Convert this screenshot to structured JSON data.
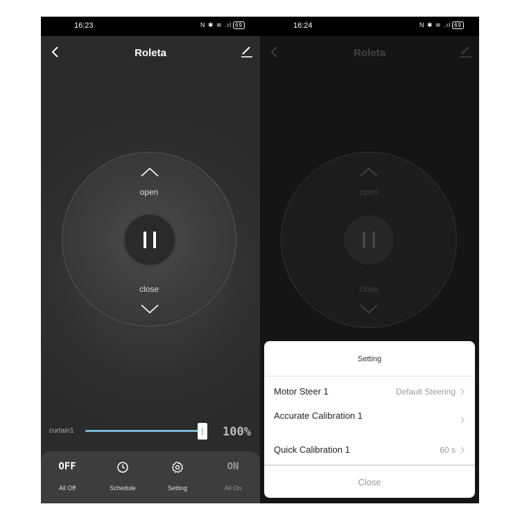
{
  "left": {
    "status_time": "16:23",
    "status_icons": "N ✱ ≋ .ıl",
    "battery": "69",
    "title": "Roleta",
    "open_label": "open",
    "close_label": "close",
    "curtain_label": "curtain1",
    "position_percent": "100%",
    "position_value": 1.0,
    "bottom_items": [
      {
        "icon_text": "OFF",
        "label": "All Off"
      },
      {
        "icon_text": "",
        "label": "Schedule"
      },
      {
        "icon_text": "",
        "label": "Setting"
      },
      {
        "icon_text": "ON",
        "label": "All On"
      }
    ]
  },
  "right": {
    "status_time": "16:24",
    "status_icons": "N ✱ ≋ .ıl",
    "battery": "69",
    "title": "Roleta",
    "open_label": "open",
    "close_label": "close",
    "sheet": {
      "title": "Setting",
      "rows": [
        {
          "name": "Motor Steer 1",
          "value": "Default Steering"
        },
        {
          "name": "Accurate Calibration 1",
          "value": ""
        },
        {
          "name": "Quick Calibration 1",
          "value": "60 s"
        }
      ],
      "close_label": "Close"
    }
  },
  "colors": {
    "accent": "#79b9d6",
    "background_left": "#2b2b2b",
    "background_right": "#151515"
  }
}
